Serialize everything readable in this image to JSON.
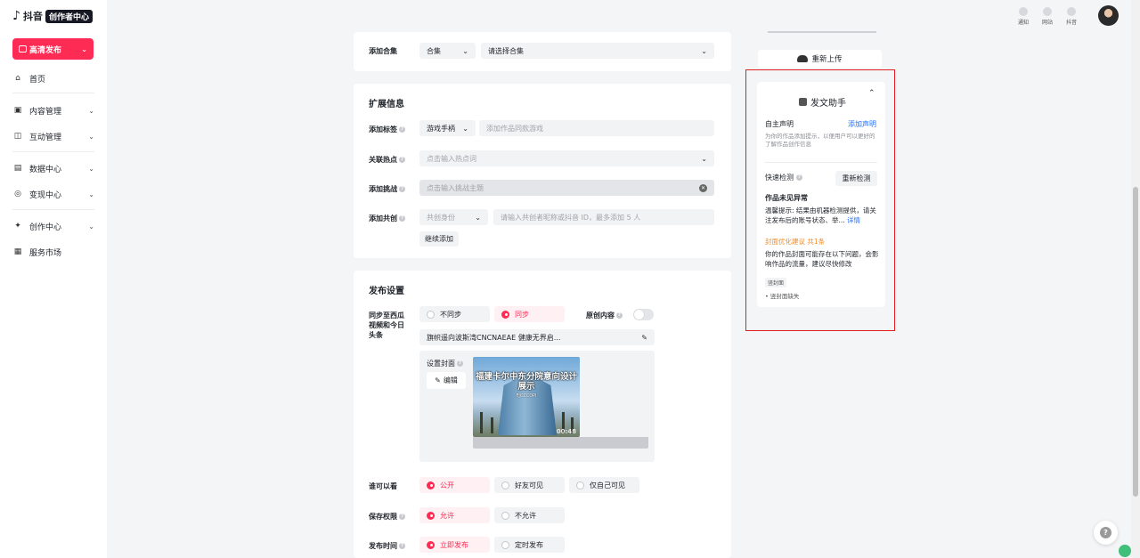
{
  "logo": {
    "name": "抖音",
    "tag": "创作者中心"
  },
  "publish_button": "高清发布",
  "nav": [
    {
      "label": "首页",
      "icon": "home-icon",
      "glyph": "⌂",
      "chevron": false
    },
    {
      "label": "内容管理",
      "icon": "content-icon",
      "glyph": "▣",
      "chevron": true
    },
    {
      "label": "互动管理",
      "icon": "interaction-icon",
      "glyph": "◫",
      "chevron": true
    },
    {
      "label": "数据中心",
      "icon": "data-icon",
      "glyph": "▤",
      "chevron": true
    },
    {
      "label": "变现中心",
      "icon": "monetize-icon",
      "glyph": "◎",
      "chevron": true
    },
    {
      "label": "创作中心",
      "icon": "create-icon",
      "glyph": "✦",
      "chevron": true
    },
    {
      "label": "服务市场",
      "icon": "market-icon",
      "glyph": "▦",
      "chevron": false
    }
  ],
  "top_icons": [
    {
      "label": "通知",
      "icon": "bell-icon"
    },
    {
      "label": "网站",
      "icon": "website-icon"
    },
    {
      "label": "抖音",
      "icon": "douyin-icon"
    }
  ],
  "collection": {
    "label": "添加合集",
    "type_value": "合集",
    "placeholder": "请选择合集"
  },
  "extended": {
    "title": "扩展信息",
    "tags": {
      "label": "添加标签",
      "value": "游戏手柄",
      "placeholder": "添加作品同款游戏"
    },
    "hotspot": {
      "label": "关联热点",
      "placeholder": "点击输入热点词"
    },
    "challenge": {
      "label": "添加挑战",
      "placeholder": "点击输入挑战主题"
    },
    "cocreate": {
      "label": "添加共创",
      "role_placeholder": "共创身份",
      "id_placeholder": "请输入共创者昵称或抖音 ID，最多添加 5 人",
      "continue": "继续添加"
    }
  },
  "publish_settings": {
    "title": "发布设置",
    "sync_label": "同步至西瓜视频和今日头条",
    "sync_options": [
      "不同步",
      "同步"
    ],
    "original_label": "原创内容",
    "xigua_title": "旗帜遥向波斯湾CNCNAEAE 健康无界启...",
    "cover": {
      "label": "设置封面",
      "edit": "编辑",
      "title_text": "福建卡尔中东分院意向设计展示",
      "sub_text": "FJCZCDPI",
      "duration": "00:48"
    },
    "visibility": {
      "label": "谁可以看",
      "options": [
        "公开",
        "好友可见",
        "仅自己可见"
      ]
    },
    "save": {
      "label": "保存权限",
      "options": [
        "允许",
        "不允许"
      ]
    },
    "time": {
      "label": "发布时间",
      "options": [
        "立即发布",
        "定时发布"
      ]
    }
  },
  "reupload": "重新上传",
  "assistant": {
    "title": "发文助手",
    "declaration": "自主声明",
    "declaration_link": "添加声明",
    "declaration_desc": "为你的作品添加提示，以便用户可以更好的了解作品创作信息",
    "quick_check": "快速检测",
    "recheck": "重新检测",
    "status": "作品未见异常",
    "tip": "温馨提示: 结果由机器检测提供，请关注发布后的账号状态、举...",
    "detail": "详情",
    "cover_suggest": "封面优化建议 共1条",
    "cover_desc": "你的作品封面可能存在以下问题，会影响作品的流量，建议尽快修改",
    "chip": "竖封面",
    "tiny": "• 竖封面缺失"
  },
  "colors": {
    "brand": "#fe2c55",
    "link": "#1e6fff",
    "warning": "#f08a24",
    "highlight_frame": "#e02020"
  }
}
